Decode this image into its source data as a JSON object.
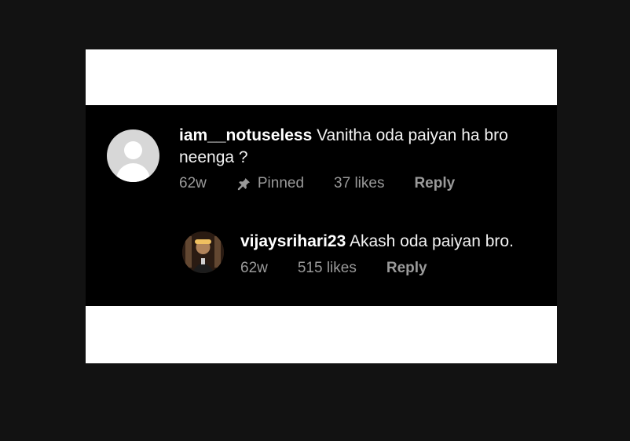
{
  "comments": [
    {
      "username": "iam__notuseless",
      "text": "Vanitha oda paiyan ha bro neenga ?",
      "time": "62w",
      "pinned_label": "Pinned",
      "likes": "37 likes",
      "reply_label": "Reply",
      "avatar_icon": "default-user-avatar-icon",
      "pin_icon": "pin-icon"
    },
    {
      "username": "vijaysrihari23",
      "text": "Akash oda paiyan bro.",
      "time": "62w",
      "likes": "515 likes",
      "reply_label": "Reply",
      "avatar_icon": "user-photo-avatar"
    }
  ],
  "colors": {
    "page_background": "#121212",
    "frame_background": "#ffffff",
    "comment_band": "#000000",
    "primary_text": "#f2f2f2",
    "secondary_text": "#9a9a9a",
    "default_avatar": "#d7d7d7"
  }
}
